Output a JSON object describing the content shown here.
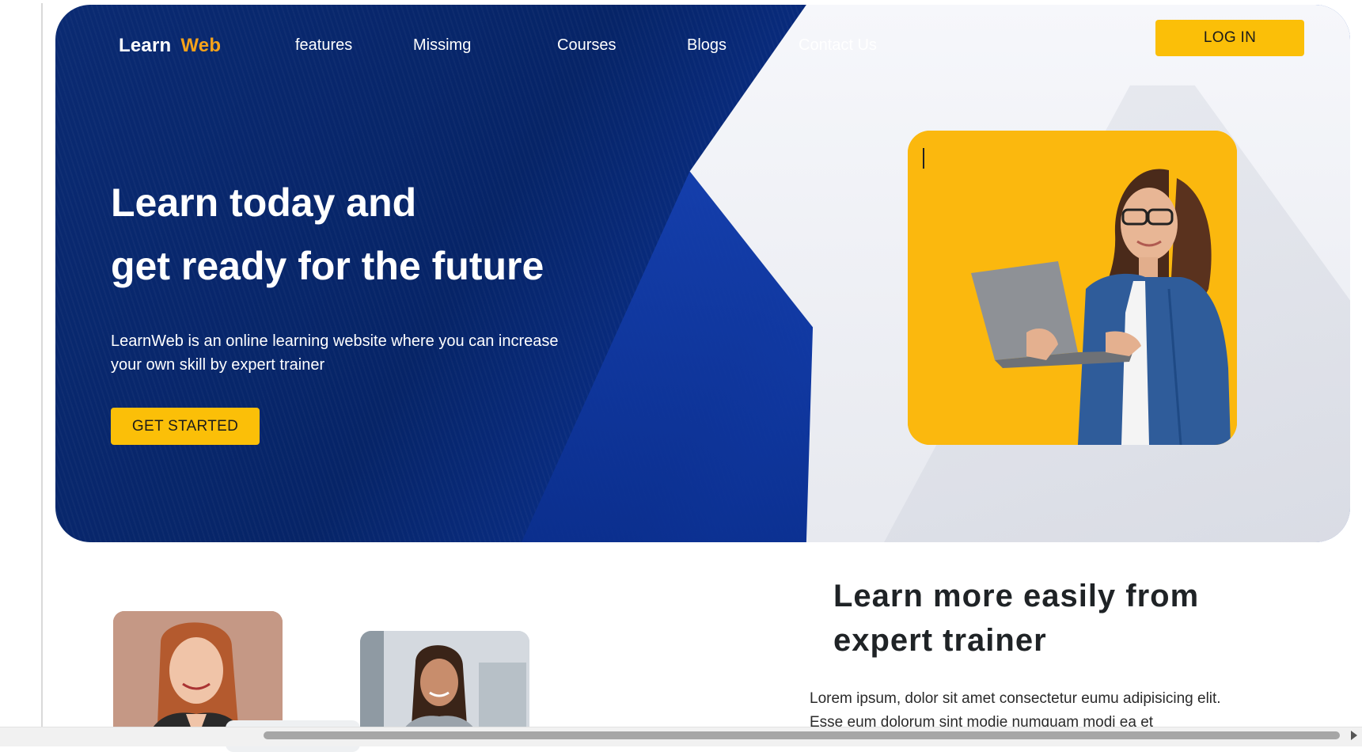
{
  "header": {
    "logo_main": "Learn",
    "logo_accent": "Web",
    "nav": [
      {
        "label": "features"
      },
      {
        "label": "Missimg"
      },
      {
        "label": "Courses"
      },
      {
        "label": "Blogs"
      },
      {
        "label": "Contact Us"
      }
    ],
    "login_label": "LOG IN"
  },
  "hero": {
    "title_line1": "Learn today and",
    "title_line2": "get ready for the future",
    "description": "LearnWeb is an online learning website where you can increase your own skill by expert trainer",
    "cta_label": "GET STARTED"
  },
  "section": {
    "title_line1": "Learn more easily from",
    "title_line2": "expert trainer",
    "text": "Lorem ipsum, dolor sit amet consectetur eumu adipisicing elit. Esse eum dolorum sint modie numquam modi ea et"
  },
  "colors": {
    "brand_blue": "#062467",
    "accent_yellow": "#fbbf08",
    "logo_accent": "#f6a21a"
  }
}
